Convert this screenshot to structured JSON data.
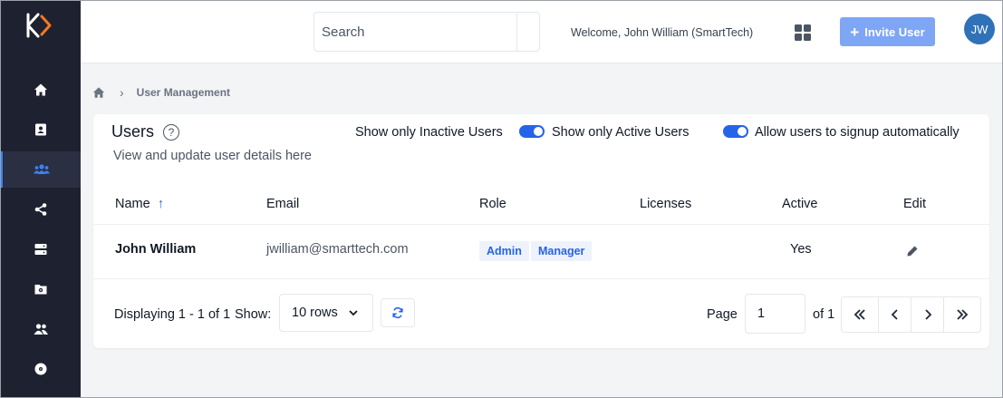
{
  "header": {
    "search_placeholder": "Search",
    "welcome_text": "Welcome, John William (SmartTech)",
    "invite_label": "Invite User",
    "avatar_initials": "JW"
  },
  "sidebar": {
    "items": [
      {
        "icon": "home-icon"
      },
      {
        "icon": "contact-card-icon"
      },
      {
        "icon": "users-group-icon",
        "active": true
      },
      {
        "icon": "share-icon"
      },
      {
        "icon": "server-icon"
      },
      {
        "icon": "folder-settings-icon"
      },
      {
        "icon": "user-pair-icon"
      },
      {
        "icon": "disc-icon"
      }
    ]
  },
  "breadcrumb": {
    "current": "User Management"
  },
  "panel": {
    "title": "Users",
    "subtitle": "View and update user details here",
    "toggles": {
      "inactive": "Show only Inactive Users",
      "active": "Show only Active Users",
      "signup": "Allow users to signup automatically"
    }
  },
  "table": {
    "columns": {
      "name": "Name",
      "email": "Email",
      "role": "Role",
      "licenses": "Licenses",
      "active": "Active",
      "edit": "Edit"
    },
    "rows": [
      {
        "name": "John William",
        "email": "jwilliam@smarttech.com",
        "roles": [
          "Admin",
          "Manager"
        ],
        "licenses": "",
        "active": "Yes"
      }
    ]
  },
  "footer": {
    "displaying": "Displaying 1 - 1 of 1",
    "show_label": "Show:",
    "rows_option": "10 rows",
    "page_label": "Page",
    "page_value": "1",
    "of_label": "of 1"
  },
  "colors": {
    "accent": "#2563eb",
    "sidebar_bg": "#1e2230",
    "invite_bg": "#7ea6f5",
    "avatar_bg": "#2f72b8"
  }
}
